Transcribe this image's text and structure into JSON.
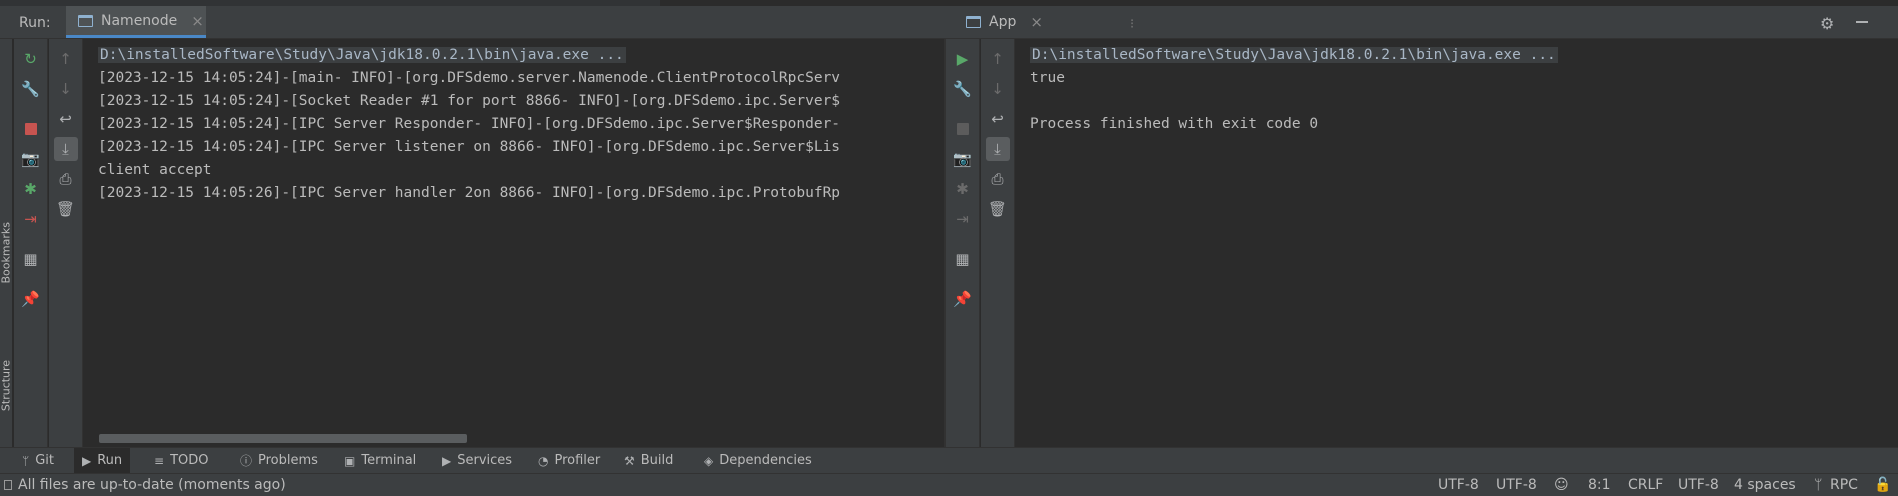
{
  "run_panel": {
    "label": "Run:",
    "tabs": [
      {
        "name": "Namenode",
        "active": true
      },
      {
        "name": "App",
        "active": false
      }
    ]
  },
  "side_labels": [
    "Bookmarks",
    "Structure"
  ],
  "left_console": {
    "command": "D:\\installedSoftware\\Study\\Java\\jdk18.0.2.1\\bin\\java.exe ...",
    "lines": [
      "[2023-12-15 14:05:24]-[main- INFO]-[org.DFSdemo.server.Namenode.ClientProtocolRpcServ",
      "[2023-12-15 14:05:24]-[Socket Reader #1 for port 8866- INFO]-[org.DFSdemo.ipc.Server$",
      "[2023-12-15 14:05:24]-[IPC Server Responder- INFO]-[org.DFSdemo.ipc.Server$Responder-",
      "[2023-12-15 14:05:24]-[IPC Server listener on 8866- INFO]-[org.DFSdemo.ipc.Server$Lis",
      "client accept",
      "[2023-12-15 14:05:26]-[IPC Server handler 2on 8866- INFO]-[org.DFSdemo.ipc.ProtobufRp"
    ]
  },
  "right_console": {
    "command": "D:\\installedSoftware\\Study\\Java\\jdk18.0.2.1\\bin\\java.exe ...",
    "lines": [
      "true",
      "",
      "Process finished with exit code 0"
    ]
  },
  "tool_windows": [
    {
      "label": "Git",
      "icon": "git-branch-icon"
    },
    {
      "label": "Run",
      "icon": "run-icon",
      "active": true
    },
    {
      "label": "TODO",
      "icon": "todo-icon"
    },
    {
      "label": "Problems",
      "icon": "problems-icon"
    },
    {
      "label": "Terminal",
      "icon": "terminal-icon"
    },
    {
      "label": "Services",
      "icon": "services-icon"
    },
    {
      "label": "Profiler",
      "icon": "profiler-icon"
    },
    {
      "label": "Build",
      "icon": "build-icon"
    },
    {
      "label": "Dependencies",
      "icon": "dependencies-icon"
    }
  ],
  "status_bar": {
    "message": "All files are up-to-date (moments ago)",
    "encoding_1": "UTF-8",
    "encoding_2": "UTF-8",
    "position": "8:1",
    "line_separator": "CRLF",
    "encoding_3": "UTF-8",
    "indent": "4 spaces",
    "branch": "RPC"
  },
  "colors": {
    "background": "#2b2b2b",
    "panel": "#3c3f41",
    "accent": "#4a88c7",
    "green": "#59a869",
    "red": "#c75450"
  }
}
